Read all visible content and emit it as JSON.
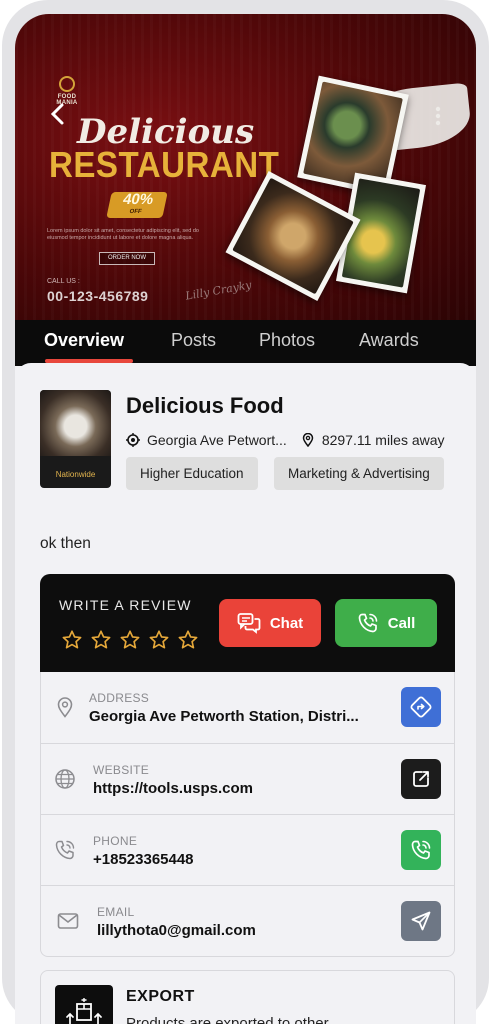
{
  "banner": {
    "logo_text": "FOOD MANIA",
    "title_line1": "Delicious",
    "title_line2": "RESTAURANT",
    "promo_percent": "40%",
    "promo_off": "OFF",
    "fine_print": "Lorem ipsum dolor sit amet, consectetur adipiscing elit, sed do eiusmod tempor incididunt ut labore et dolore magna aliqua.",
    "order_button": "ORDER NOW",
    "call_label": "CALL US :",
    "phone_number": "00-123-456789",
    "signature": "Lilly Crayky"
  },
  "tabs": [
    {
      "label": "Overview",
      "active": true
    },
    {
      "label": "Posts",
      "active": false
    },
    {
      "label": "Photos",
      "active": false
    },
    {
      "label": "Awards",
      "active": false
    }
  ],
  "business": {
    "name": "Delicious Food",
    "thumb_label": "Nationwide",
    "location": "Georgia Ave Petwort...",
    "distance": "8297.11 miles away",
    "categories": [
      "Higher Education",
      "Marketing & Advertising"
    ],
    "description": "ok then"
  },
  "review": {
    "title": "WRITE A REVIEW",
    "stars": 5,
    "chat_label": "Chat",
    "call_label": "Call"
  },
  "info": {
    "address_key": "ADDRESS",
    "address_val": "Georgia Ave Petworth Station, Distri...",
    "website_key": "WEBSITE",
    "website_val": "https://tools.usps.com",
    "phone_key": "PHONE",
    "phone_val": "+18523365448",
    "email_key": "EMAIL",
    "email_val": "lillythota0@gmail.com"
  },
  "export": {
    "title": "EXPORT",
    "desc": "Products are exported to other"
  },
  "colors": {
    "accent": "#e8473c",
    "chat": "#ea4339",
    "call": "#3fae4a",
    "directions": "#3f6fd6",
    "website": "#1c1c1c",
    "phone": "#33b35a",
    "email": "#6e7785",
    "star": "#e5a83a"
  }
}
